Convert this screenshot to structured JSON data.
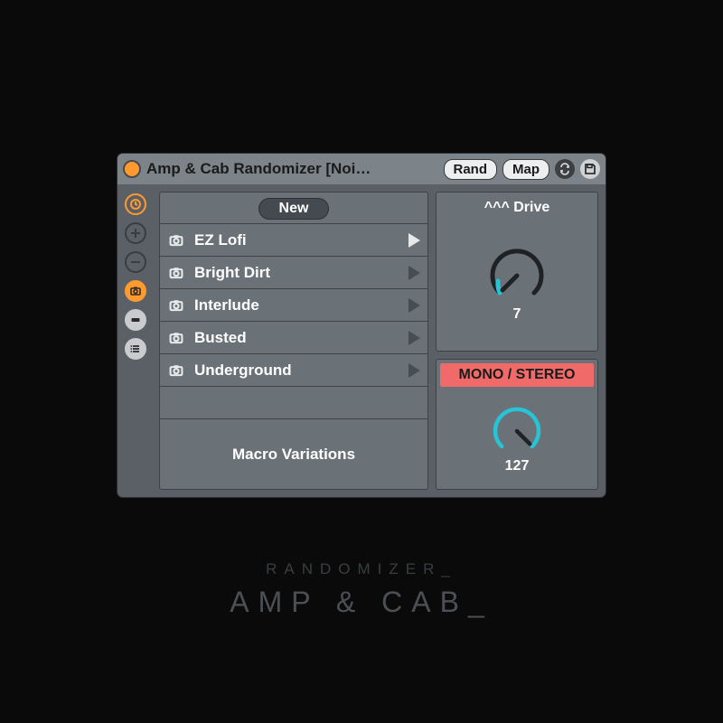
{
  "titlebar": {
    "title": "Amp & Cab Randomizer [Noi…",
    "rand_label": "Rand",
    "map_label": "Map"
  },
  "sidebar": {
    "icons": [
      "history-icon",
      "plus-icon",
      "minus-icon",
      "camera-icon",
      "collapse-icon",
      "list-icon"
    ]
  },
  "presets": {
    "new_label": "New",
    "items": [
      {
        "label": "EZ Lofi",
        "active": true
      },
      {
        "label": "Bright Dirt",
        "active": false
      },
      {
        "label": "Interlude",
        "active": false
      },
      {
        "label": "Busted",
        "active": false
      },
      {
        "label": "Underground",
        "active": false
      }
    ],
    "footer": "Macro Variations"
  },
  "params": {
    "drive": {
      "label": "^^^ Drive",
      "value": "7"
    },
    "mono": {
      "label": "MONO / STEREO",
      "value": "127"
    }
  },
  "caption": {
    "line1": "RANDOMIZER_",
    "line2": "AMP & CAB_"
  },
  "colors": {
    "accent_orange": "#ff9a2e",
    "accent_cyan": "#27c3d6",
    "warn_red": "#f06a6a"
  }
}
